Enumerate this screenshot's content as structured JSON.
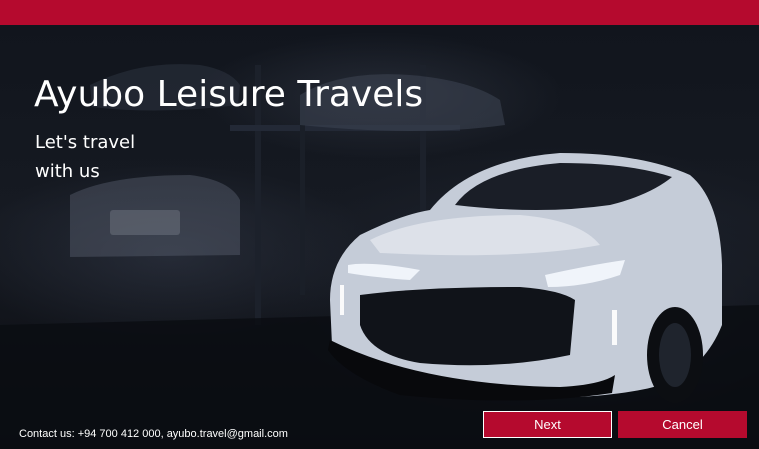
{
  "header": {
    "title": "Ayubo Leisure Travels",
    "tagline_line1": "Let's travel",
    "tagline_line2": "with us"
  },
  "footer": {
    "contact": "Contact us: +94 700 412 000, ayubo.travel@gmail.com"
  },
  "actions": {
    "next_label": "Next",
    "cancel_label": "Cancel"
  },
  "colors": {
    "accent": "#b50a2e",
    "background": "#0d1017",
    "text": "#ffffff"
  },
  "image": {
    "subject": "white-sports-car-in-dark-garage"
  }
}
